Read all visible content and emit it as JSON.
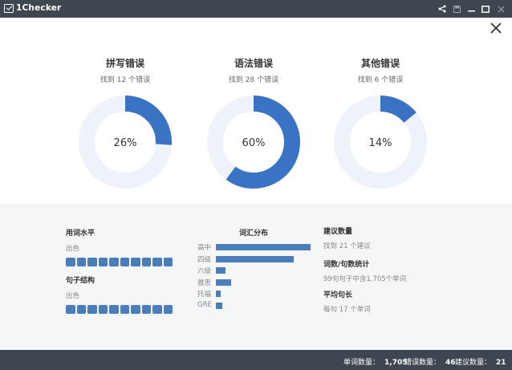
{
  "window": {
    "title": "1Checker"
  },
  "titlebar_icons": [
    "share-icon",
    "save-icon",
    "minimize-icon",
    "maximize-icon",
    "close-icon"
  ],
  "donuts": [
    {
      "title": "拼写错误",
      "subtitle": "找到 12 个错误",
      "percent": 26,
      "percent_label": "26%"
    },
    {
      "title": "语法错误",
      "subtitle": "找到 28 个错误",
      "percent": 60,
      "percent_label": "60%"
    },
    {
      "title": "其他错误",
      "subtitle": "找到 6 个错误",
      "percent": 14,
      "percent_label": "14%"
    }
  ],
  "word_level": {
    "title": "用词水平",
    "value": "出色",
    "filled_blocks": 10,
    "total_blocks": 10
  },
  "sentence_structure": {
    "title": "句子结构",
    "value": "出色",
    "filled_blocks": 10,
    "total_blocks": 10
  },
  "vocab": {
    "title": "词汇分布",
    "levels": [
      {
        "label": "高中",
        "fraction": 1.0
      },
      {
        "label": "四级",
        "fraction": 0.82
      },
      {
        "label": "六级",
        "fraction": 0.1
      },
      {
        "label": "雅思",
        "fraction": 0.16
      },
      {
        "label": "托福",
        "fraction": 0.05
      },
      {
        "label": "GRE",
        "fraction": 0.07
      }
    ]
  },
  "suggestions": {
    "title": "建议数量",
    "value": "找到 21 个建议"
  },
  "word_sentence_stats": {
    "title": "词数/句数统计",
    "value": "99句句子中含1,705个单词"
  },
  "avg_sentence_length": {
    "title": "平均句长",
    "value": "每句 17 个单词"
  },
  "colors": {
    "accent": "#3a72c4",
    "track": "#eef2f9",
    "dark": "#3e4750"
  },
  "footer": {
    "word_count_label": "单词数量：",
    "word_count_value": "1,705",
    "error_count_label": "错误数量：",
    "error_count_value": "46",
    "suggestion_count_label": "建议数量：",
    "suggestion_count_value": "21"
  }
}
